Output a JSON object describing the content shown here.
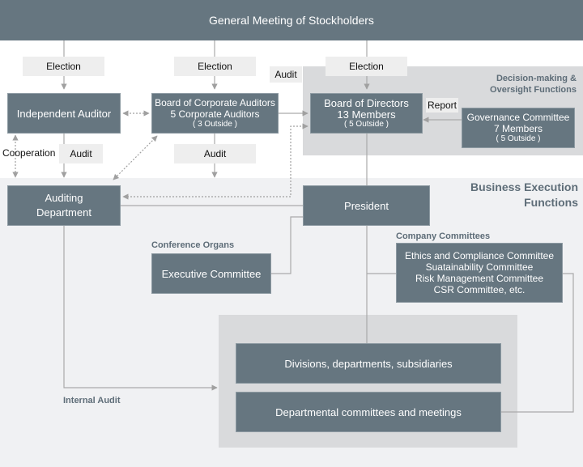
{
  "header": {
    "title": "General Meeting of Stockholders"
  },
  "labels": {
    "election_1": "Election",
    "election_2": "Election",
    "election_3": "Election",
    "audit_top": "Audit",
    "audit_left": "Audit",
    "audit_mid": "Audit",
    "cooperation": "Cooperation",
    "report": "Report"
  },
  "sections": {
    "decision": "Decision-making & Oversight Functions",
    "business": "Business Execution Functions",
    "conference_organs": "Conference Organs",
    "company_committees": "Company Committees",
    "internal_audit": "Internal Audit"
  },
  "boxes": {
    "independent_auditor": "Independent Auditor",
    "corporate_auditors": {
      "line1": "Board of Corporate Auditors",
      "line2": "5 Corporate Auditors",
      "line3": "( 3 Outside )"
    },
    "board_of_directors": {
      "line1": "Board of Directors",
      "line2": "13 Members",
      "line3": "( 5 Outside )"
    },
    "governance": {
      "line1": "Governance Committee",
      "line2": "7 Members",
      "line3": "( 5 Outside )"
    },
    "auditing_department": {
      "line1": "Auditing",
      "line2": "Department"
    },
    "president": "President",
    "executive_committee": "Executive Committee",
    "company_committees": [
      "Ethics and Compliance Committee",
      "Suatainability Committee",
      "Risk Management Committee",
      "CSR Committee, etc."
    ],
    "divisions": "Divisions, departments, subsidiaries",
    "departmental": "Departmental committees and meetings"
  },
  "colors": {
    "box": "#667680",
    "label_bg": "#eeeeee",
    "decision_region": "#d9dadc",
    "business_region": "#f0f1f3",
    "line": "#aaaaaa",
    "section_text": "#5e6d78"
  }
}
